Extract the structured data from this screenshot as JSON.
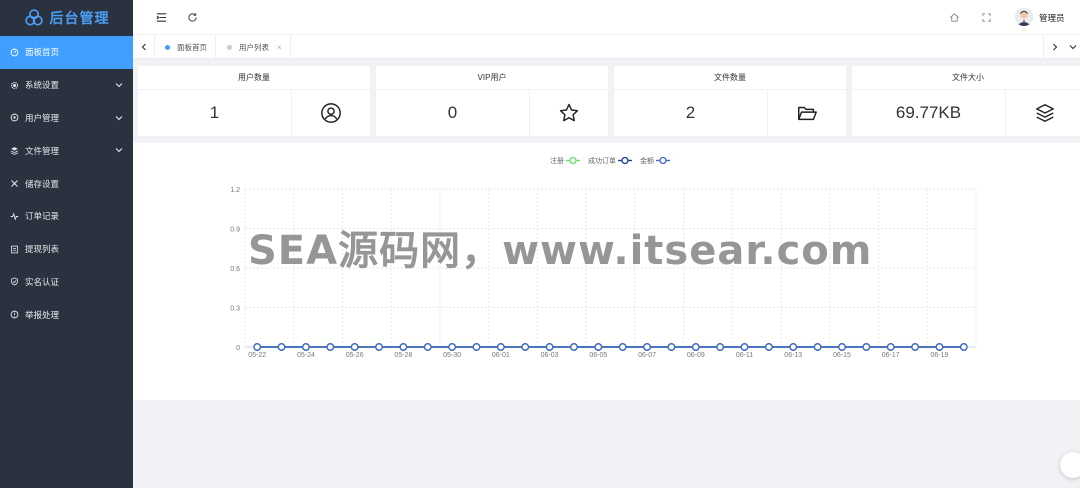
{
  "app": {
    "title": "后台管理",
    "brand_color": "#4a9ff5"
  },
  "sidebar": {
    "items": [
      {
        "label": "面板首页",
        "icon": "dashboard-icon",
        "active": true,
        "expandable": false
      },
      {
        "label": "系统设置",
        "icon": "gear-icon",
        "active": false,
        "expandable": true
      },
      {
        "label": "用户管理",
        "icon": "user-cog-icon",
        "active": false,
        "expandable": true
      },
      {
        "label": "文件管理",
        "icon": "layers-icon",
        "active": false,
        "expandable": true
      },
      {
        "label": "储存设置",
        "icon": "storage-icon",
        "active": false,
        "expandable": false
      },
      {
        "label": "订单记录",
        "icon": "activity-icon",
        "active": false,
        "expandable": false
      },
      {
        "label": "提现列表",
        "icon": "list-icon",
        "active": false,
        "expandable": false
      },
      {
        "label": "实名认证",
        "icon": "shield-check-icon",
        "active": false,
        "expandable": false
      },
      {
        "label": "举报处理",
        "icon": "alert-circle-icon",
        "active": false,
        "expandable": false
      }
    ]
  },
  "header": {
    "icons": [
      "menu-toggle-icon",
      "refresh-icon",
      "home-icon",
      "fullscreen-icon"
    ],
    "user_name": "管理员"
  },
  "tabs": [
    {
      "label": "面板首页",
      "active": true
    },
    {
      "label": "用户列表",
      "active": false,
      "closable": true
    }
  ],
  "tab_close_glyph": "×",
  "stats": [
    {
      "title": "用户数量",
      "value": "1",
      "icon": "user-circle-icon"
    },
    {
      "title": "VIP用户",
      "value": "0",
      "icon": "star-icon"
    },
    {
      "title": "文件数量",
      "value": "2",
      "icon": "folder-open-icon"
    },
    {
      "title": "文件大小",
      "value": "69.77KB",
      "icon": "layers-icon"
    }
  ],
  "chart_data": {
    "type": "line",
    "legend": [
      "注册",
      "成功订单",
      "金额"
    ],
    "legend_placement": "top-center",
    "x": [
      "05-22",
      "05-23",
      "05-24",
      "05-25",
      "05-26",
      "05-27",
      "05-28",
      "05-29",
      "05-30",
      "05-31",
      "06-01",
      "06-02",
      "06-03",
      "06-04",
      "06-05",
      "06-06",
      "06-07",
      "06-08",
      "06-09",
      "06-10",
      "06-11",
      "06-12",
      "06-13",
      "06-14",
      "06-15",
      "06-16",
      "06-17",
      "06-18",
      "06-19",
      "06-20"
    ],
    "x_tick_labels": [
      "05-22",
      "05-24",
      "05-26",
      "05-28",
      "05-30",
      "06-01",
      "06-03",
      "06-05",
      "06-07",
      "06-09",
      "06-11",
      "06-13",
      "06-15",
      "06-17",
      "06-19"
    ],
    "series": [
      {
        "name": "注册",
        "color": "#67e06b",
        "values": [
          0,
          0,
          0,
          0,
          0,
          0,
          0,
          0,
          0,
          0,
          0,
          0,
          0,
          0,
          0,
          0,
          0,
          0,
          0,
          0,
          0,
          0,
          0,
          0,
          0,
          0,
          0,
          0,
          0,
          0
        ]
      },
      {
        "name": "成功订单",
        "color": "#1f3a93",
        "values": [
          0,
          0,
          0,
          0,
          0,
          0,
          0,
          0,
          0,
          0,
          0,
          0,
          0,
          0,
          0,
          0,
          0,
          0,
          0,
          0,
          0,
          0,
          0,
          0,
          0,
          0,
          0,
          0,
          0,
          0
        ]
      },
      {
        "name": "金额",
        "color": "#3f6cc4",
        "values": [
          0,
          0,
          0,
          0,
          0,
          0,
          0,
          0,
          0,
          0,
          0,
          0,
          0,
          0,
          0,
          0,
          0,
          0,
          0,
          0,
          0,
          0,
          0,
          0,
          0,
          0,
          0,
          0,
          0,
          0
        ]
      }
    ],
    "y_ticks": [
      0,
      0.3,
      0.6,
      0.9,
      1.2
    ],
    "ylim": [
      0,
      1.2
    ],
    "grid": true
  },
  "watermark": {
    "text": "SEA源码网，www.itsear.com"
  }
}
